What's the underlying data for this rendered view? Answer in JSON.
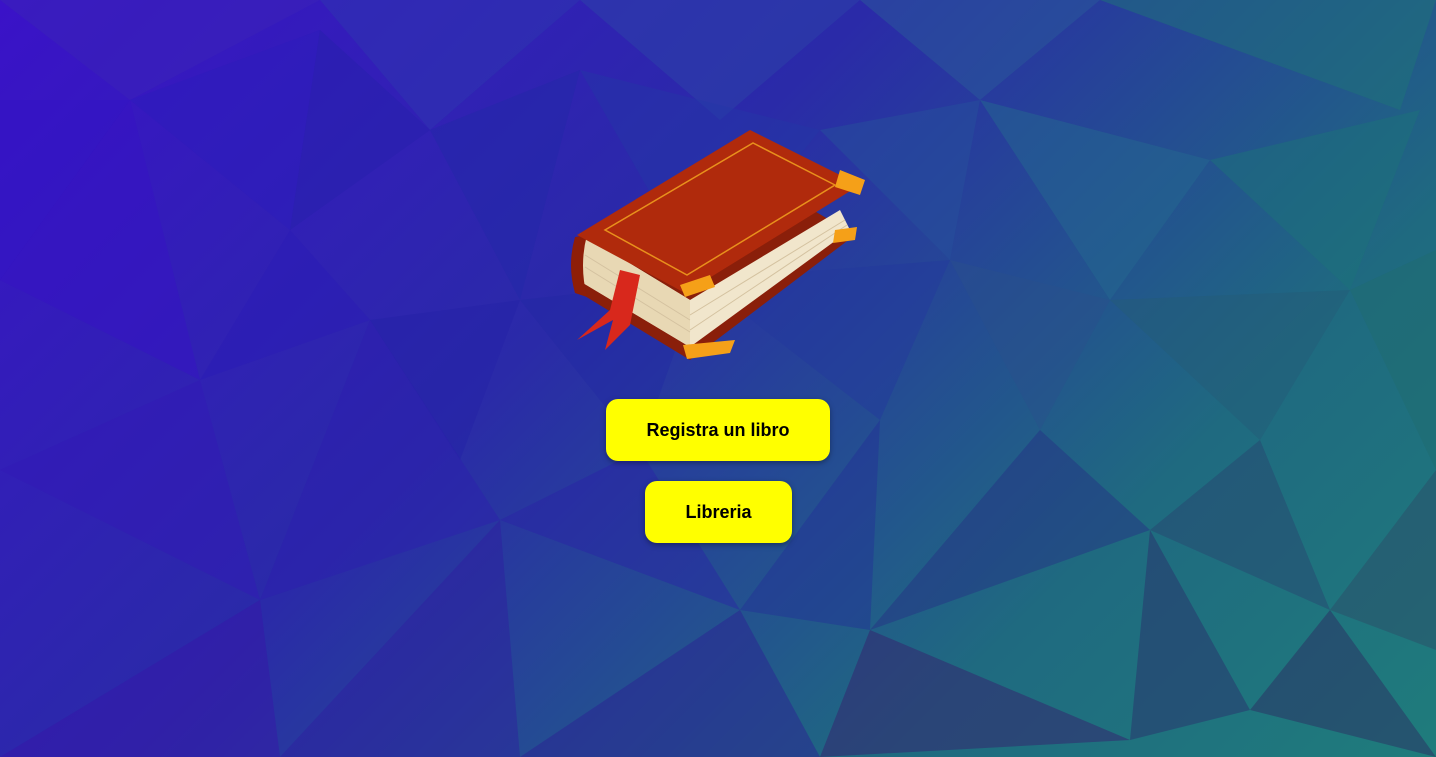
{
  "background": {
    "description_colors": [
      "#3a12c8",
      "#2a2aa8",
      "#1f6a80",
      "#1f7c7c"
    ]
  },
  "logo": {
    "icon": "book-icon",
    "colors": {
      "cover": "#b02a0c",
      "pages": "#f1e6cc",
      "corners": "#f5a018",
      "ribbon": "#d8281c"
    }
  },
  "actions": {
    "register_label": "Registra un libro",
    "library_label": "Libreria",
    "button_color": "#ffff00"
  }
}
